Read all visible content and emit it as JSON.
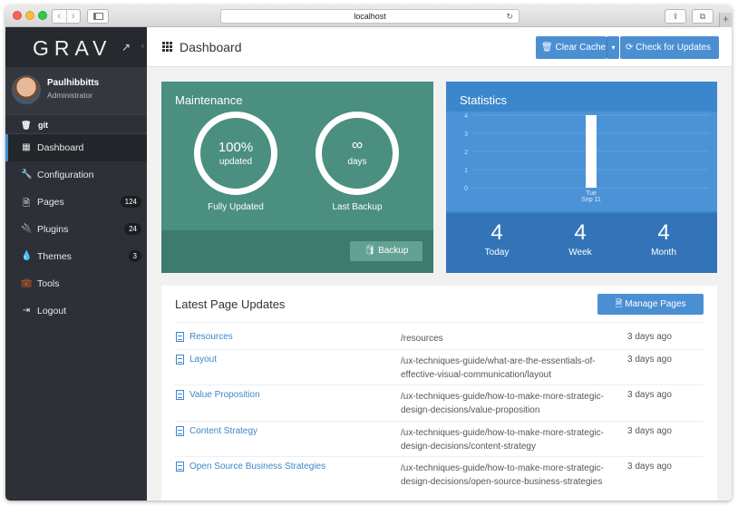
{
  "browser": {
    "url": "localhost",
    "reload_glyph": "↻",
    "back_glyph": "‹",
    "forward_glyph": "›",
    "share_glyph": "⇪",
    "tabs_glyph": "⧉",
    "newtab_glyph": "+"
  },
  "sidebar": {
    "logo": "GRAV",
    "external_glyph": "↗",
    "collapse_glyph": "‹",
    "user": {
      "name": "Paulhibbitts",
      "role": "Administrator"
    },
    "git": {
      "label": "git",
      "icon": "trash-icon",
      "glyph": "🗑"
    },
    "items": [
      {
        "label": "Dashboard",
        "icon": "grid-icon",
        "glyph": "▦",
        "badge": "",
        "active": true
      },
      {
        "label": "Configuration",
        "icon": "wrench-icon",
        "glyph": "🔧",
        "badge": ""
      },
      {
        "label": "Pages",
        "icon": "file-icon",
        "glyph": "🗎",
        "badge": "124"
      },
      {
        "label": "Plugins",
        "icon": "plug-icon",
        "glyph": "🔌",
        "badge": "24"
      },
      {
        "label": "Themes",
        "icon": "tint-icon",
        "glyph": "💧",
        "badge": "3"
      },
      {
        "label": "Tools",
        "icon": "briefcase-icon",
        "glyph": "💼",
        "badge": ""
      },
      {
        "label": "Logout",
        "icon": "sign-out-icon",
        "glyph": "⇥",
        "badge": ""
      }
    ]
  },
  "header": {
    "title": "Dashboard",
    "clear_cache": "Clear Cache",
    "clear_cache_glyph": "🗑",
    "caret_glyph": "▾",
    "check_updates": "Check for Updates",
    "check_updates_glyph": "⟳"
  },
  "maintenance": {
    "title": "Maintenance",
    "updated_value": "100%",
    "updated_sub": "updated",
    "updated_label": "Fully Updated",
    "backup_value": "∞",
    "backup_sub": "days",
    "backup_label": "Last Backup",
    "backup_button": "Backup",
    "backup_glyph": "🛢"
  },
  "statistics": {
    "title": "Statistics",
    "today_value": "4",
    "today_label": "Today",
    "week_value": "4",
    "week_label": "Week",
    "month_value": "4",
    "month_label": "Month"
  },
  "chart_data": {
    "type": "bar",
    "categories": [
      "Tue Sep 11"
    ],
    "category_lines": [
      [
        "Tue",
        "Sep 11"
      ]
    ],
    "values": [
      4
    ],
    "ylim": [
      0,
      4
    ],
    "yticks": [
      0,
      1,
      2,
      3,
      4
    ],
    "colors": {
      "bar": "#ffffff"
    }
  },
  "pages": {
    "title": "Latest Page Updates",
    "manage_button": "Manage Pages",
    "manage_glyph": "🗎",
    "rows": [
      {
        "title": "Resources",
        "route": "/resources",
        "date": "3 days ago"
      },
      {
        "title": "Layout",
        "route": "/ux-techniques-guide/what-are-the-essentials-of-effective-visual-communication/layout",
        "date": "3 days ago"
      },
      {
        "title": "Value Proposition",
        "route": "/ux-techniques-guide/how-to-make-more-strategic-design-decisions/value-proposition",
        "date": "3 days ago"
      },
      {
        "title": "Content Strategy",
        "route": "/ux-techniques-guide/how-to-make-more-strategic-design-decisions/content-strategy",
        "date": "3 days ago"
      },
      {
        "title": "Open Source Business Strategies",
        "route": "/ux-techniques-guide/how-to-make-more-strategic-design-decisions/open-source-business-strategies",
        "date": "3 days ago"
      }
    ]
  }
}
